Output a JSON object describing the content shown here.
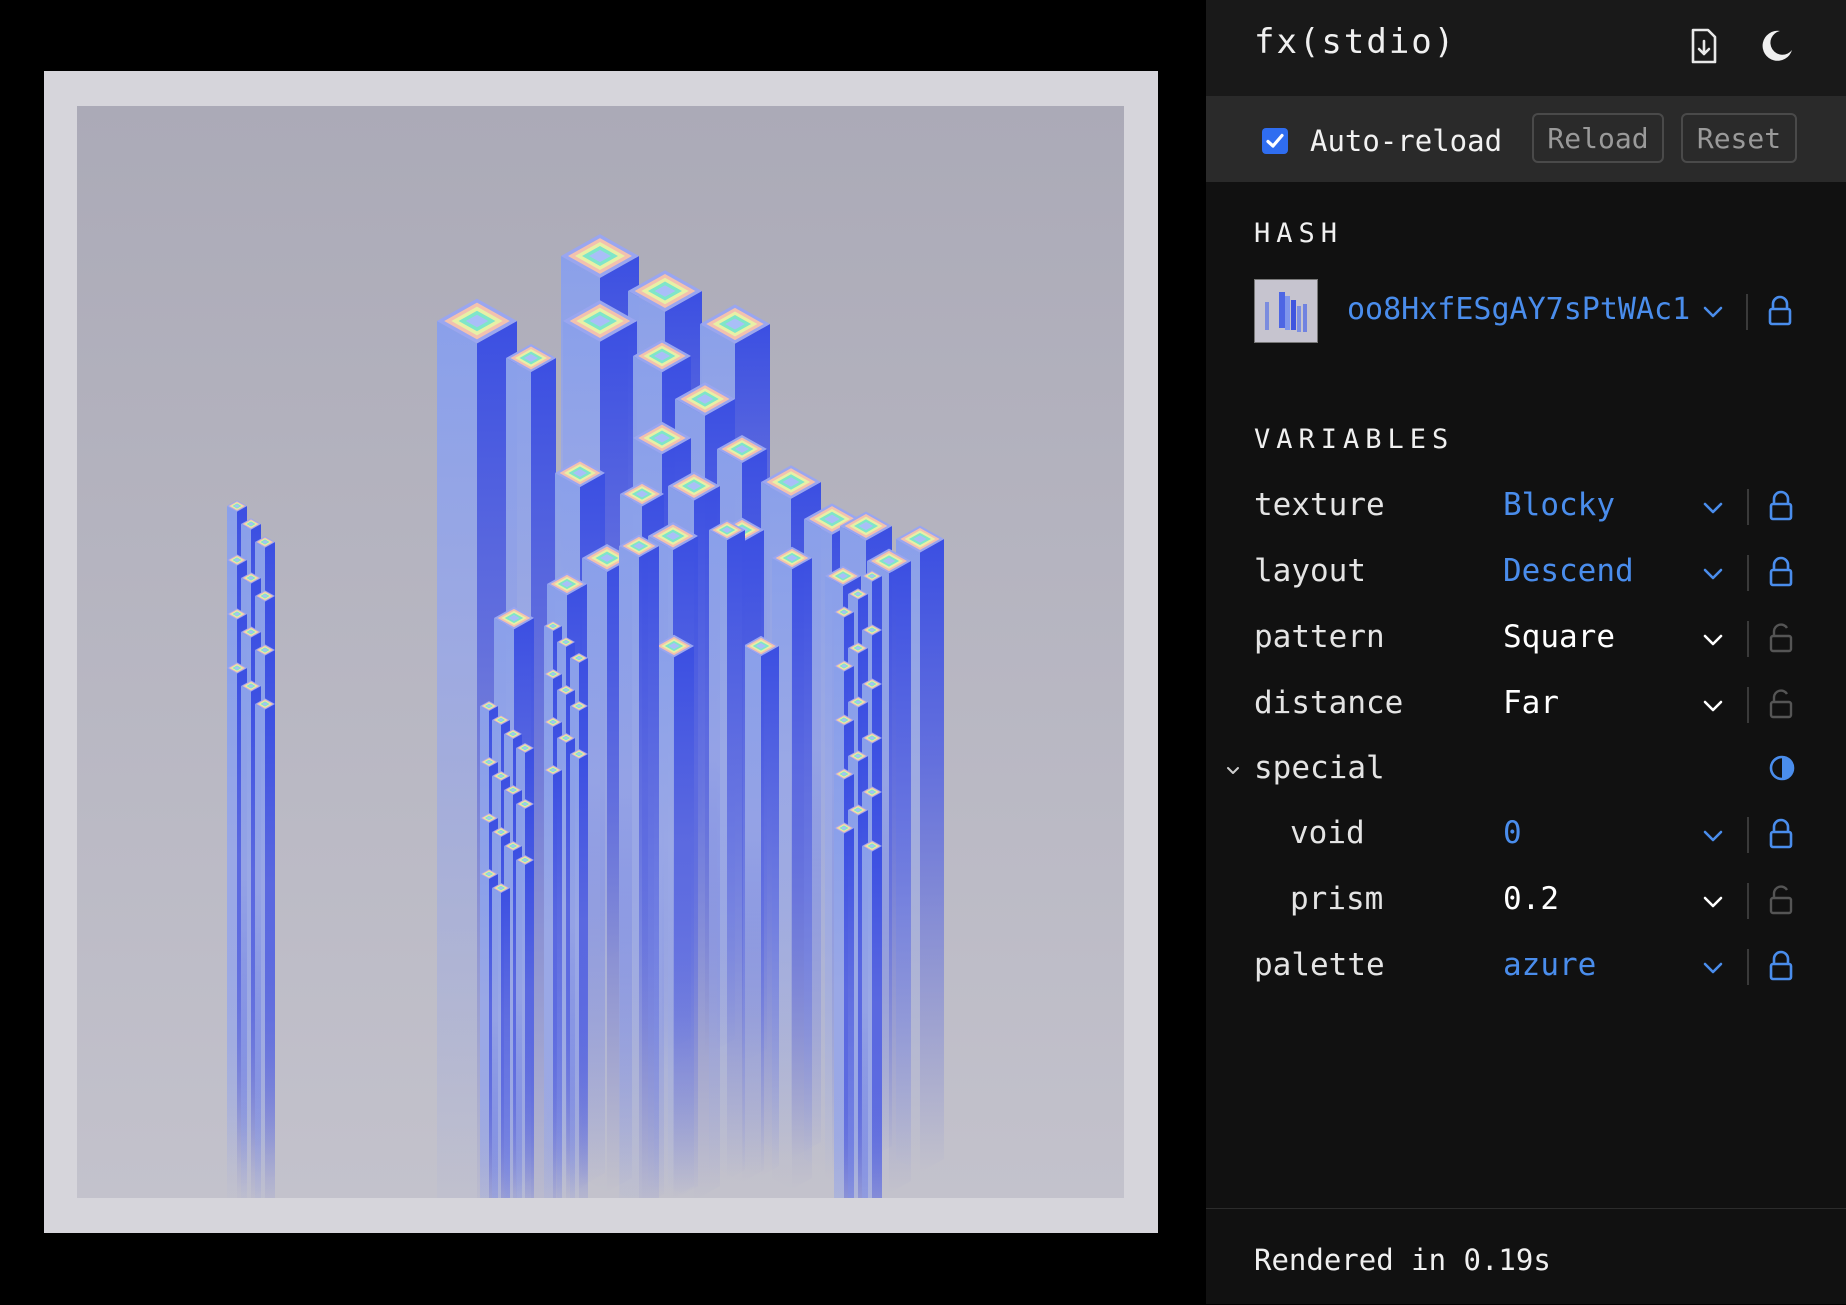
{
  "app": {
    "title": "fx(stdio)"
  },
  "toolbar": {
    "auto_reload_label": "Auto-reload",
    "auto_reload_checked": true,
    "reload_label": "Reload",
    "reset_label": "Reset"
  },
  "hash": {
    "section_title": "HASH",
    "value": "oo8HxfESgAY7sPtWAc1",
    "locked": true
  },
  "variables": {
    "section_title": "VARIABLES",
    "texture": {
      "name": "texture",
      "value": "Blocky",
      "locked": true
    },
    "layout": {
      "name": "layout",
      "value": "Descend",
      "locked": true
    },
    "pattern": {
      "name": "pattern",
      "value": "Square",
      "locked": false
    },
    "distance": {
      "name": "distance",
      "value": "Far",
      "locked": false
    },
    "special": {
      "name": "special",
      "expanded": true,
      "void": {
        "name": "void",
        "value": "0",
        "locked": true
      },
      "prism": {
        "name": "prism",
        "value": "0.2",
        "locked": false
      }
    },
    "palette": {
      "name": "palette",
      "value": "azure",
      "locked": true
    }
  },
  "status": {
    "render_text": "Rendered in 0.19s"
  },
  "colors": {
    "accent": "#4a8dec",
    "panel_bg": "#111111",
    "header_bg": "#191919",
    "toolbar_bg": "#2a2a2a",
    "checkbox": "#2f6df0"
  }
}
